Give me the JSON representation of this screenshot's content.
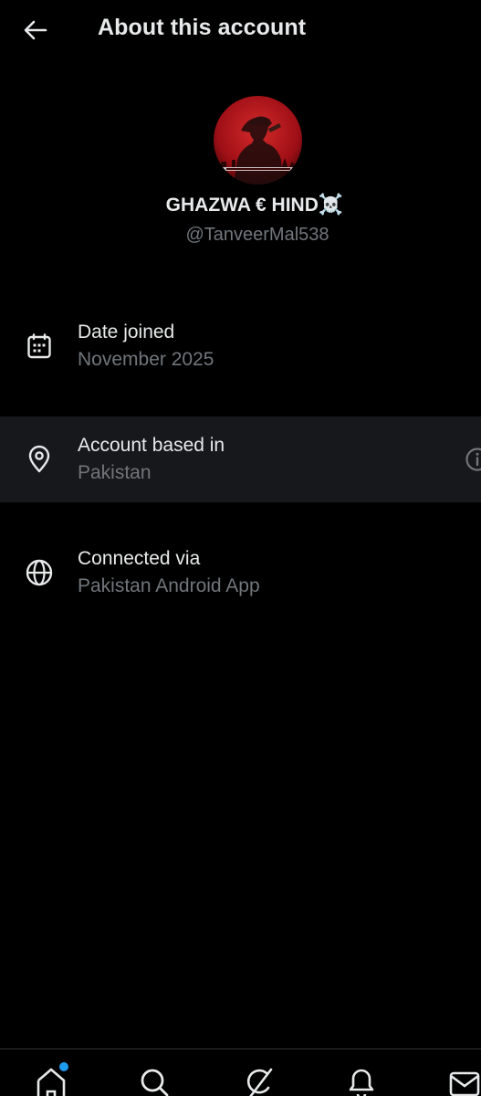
{
  "header": {
    "title": "About this account",
    "back_icon": "arrow-left-icon"
  },
  "profile": {
    "display_name": "GHAZWA € HIND",
    "display_name_emoji": "☠️",
    "handle": "@TanveerMal538",
    "avatar_bg_color": "#b3141b"
  },
  "details": [
    {
      "icon": "calendar-icon",
      "label": "Date joined",
      "value": "November 2025"
    },
    {
      "icon": "location-pin-icon",
      "label": "Account based in",
      "value": "Pakistan",
      "has_info_icon": true
    },
    {
      "icon": "globe-icon",
      "label": "Connected via",
      "value": "Pakistan Android App"
    }
  ],
  "bottom_nav": {
    "items": [
      "home-icon",
      "search-icon",
      "grok-icon",
      "notifications-icon",
      "messages-icon"
    ],
    "home_has_dot": true,
    "dot_color": "#1d9bf0"
  },
  "colors": {
    "background": "#000000",
    "primary_text": "#e7e9ea",
    "secondary_text": "#71767b",
    "highlight_row": "#16181c",
    "accent": "#1d9bf0"
  }
}
